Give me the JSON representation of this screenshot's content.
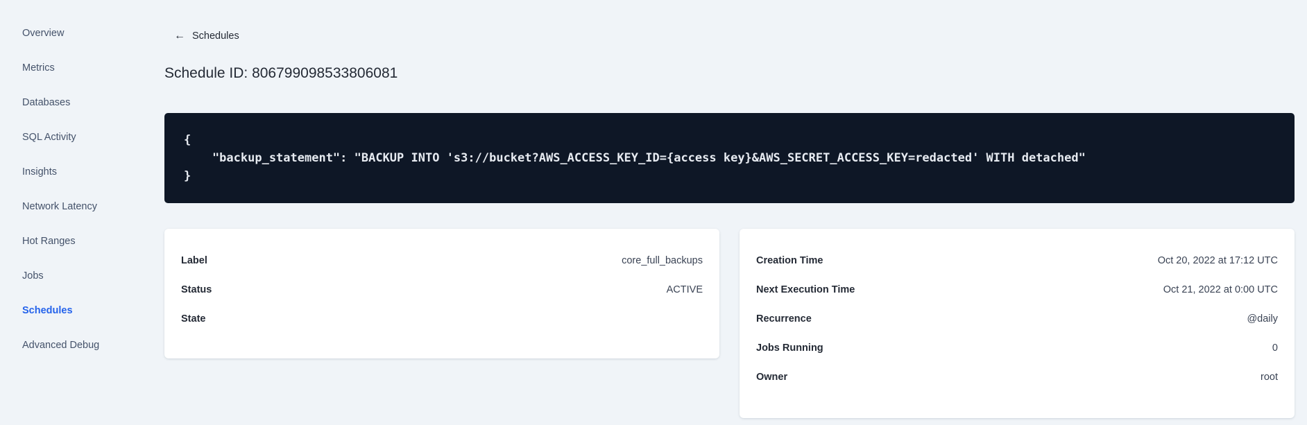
{
  "colors": {
    "page_background": "#f0f4f8",
    "active_link_blue": "#2563eb",
    "code_block_background": "#0e1726",
    "code_text": "#e7ebf1",
    "card_background": "#ffffff",
    "heading_text": "#242a35"
  },
  "sidebar": {
    "items": [
      {
        "label": "Overview",
        "active": false
      },
      {
        "label": "Metrics",
        "active": false
      },
      {
        "label": "Databases",
        "active": false
      },
      {
        "label": "SQL Activity",
        "active": false
      },
      {
        "label": "Insights",
        "active": false
      },
      {
        "label": "Network Latency",
        "active": false
      },
      {
        "label": "Hot Ranges",
        "active": false
      },
      {
        "label": "Jobs",
        "active": false
      },
      {
        "label": "Schedules",
        "active": true
      },
      {
        "label": "Advanced Debug",
        "active": false
      }
    ]
  },
  "header": {
    "back_icon": "arrow-left",
    "back_label": "Schedules",
    "title": "Schedule ID: 806799098533806081"
  },
  "code_block": {
    "lines": [
      "{",
      "    \"backup_statement\": \"BACKUP INTO 's3://bucket?AWS_ACCESS_KEY_ID={access key}&AWS_SECRET_ACCESS_KEY=redacted' WITH detached\"",
      "}"
    ]
  },
  "details_card": {
    "rows": [
      {
        "label": "Label",
        "value": "core_full_backups"
      },
      {
        "label": "Status",
        "value": "ACTIVE"
      },
      {
        "label": "State",
        "value": ""
      }
    ]
  },
  "schedule_card": {
    "rows": [
      {
        "label": "Creation Time",
        "value": "Oct 20, 2022 at 17:12 UTC"
      },
      {
        "label": "Next Execution Time",
        "value": "Oct 21, 2022 at 0:00 UTC"
      },
      {
        "label": "Recurrence",
        "value": "@daily"
      },
      {
        "label": "Jobs Running",
        "value": "0"
      },
      {
        "label": "Owner",
        "value": "root"
      }
    ]
  }
}
